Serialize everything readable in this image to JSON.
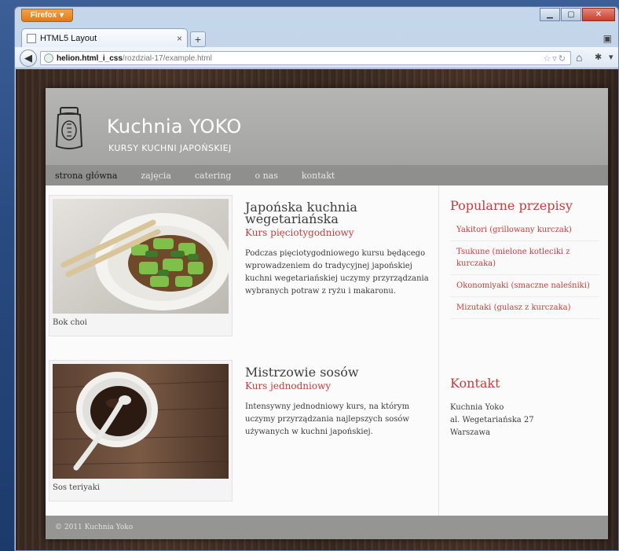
{
  "browser": {
    "app_button": "Firefox",
    "tab_title": "HTML5 Layout",
    "new_tab": "+",
    "url_host": "helion.html_i_css",
    "url_path": "/rozdzial-17/example.html"
  },
  "site": {
    "title": "Kuchnia YOKO",
    "subtitle": "KURSY KUCHNI JAPOŃSKIEJ",
    "nav": [
      "strona główna",
      "zajęcia",
      "catering",
      "o nas",
      "kontakt"
    ],
    "active_nav": 0
  },
  "articles": [
    {
      "caption": "Bok choi",
      "title": "Japońska kuchnia wegetariańska",
      "subtitle": "Kurs pięciotygodniowy",
      "body": "Podczas pięciotygodniowego kursu będącego wprowadzeniem do tradycyjnej japońskiej kuchni wegetariańskiej uczymy przyrządzania wybranych potraw z ryżu i makaronu."
    },
    {
      "caption": "Sos teriyaki",
      "title": "Mistrzowie sosów",
      "subtitle": "Kurs jednodniowy",
      "body": "Intensywny jednodniowy kurs, na którym uczymy przyrządzania najlepszych sosów używanych w kuchni japońskiej."
    }
  ],
  "sidebar": {
    "popular_title": "Popularne przepisy",
    "recipes": [
      "Yakitori (grillowany kurczak)",
      "Tsukune (mielone kotleciki z kurczaka)",
      "Okonomiyaki (smaczne naleśniki)",
      "Mizutaki (gulasz z kurczaka)"
    ],
    "contact_title": "Kontakt",
    "contact_lines": [
      "Kuchnia Yoko",
      "al. Wegetariańska 27",
      "Warszawa"
    ]
  },
  "footer": "© 2011 Kuchnia Yoko",
  "colors": {
    "accent_red": "#c83c3c",
    "header_gray": "#a4a4a2",
    "firefox_orange": "#e07a1a"
  }
}
